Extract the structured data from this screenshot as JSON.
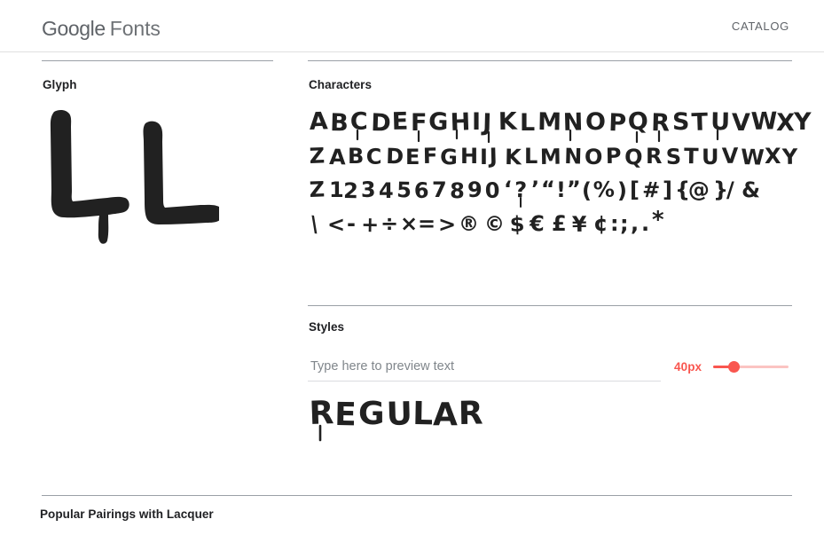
{
  "page": {
    "background": "#ffffff",
    "accent_color": "#f9564f",
    "text_color": "#212121",
    "muted_color": "#5f6368"
  },
  "header": {
    "logo_primary": "Google",
    "logo_secondary": "Fonts",
    "nav": {
      "catalog_label": "CATALOG"
    }
  },
  "glyph_section": {
    "label": "Glyph",
    "glyph_text": "LL"
  },
  "characters_section": {
    "label": "Characters",
    "rows": [
      "ABCDEFGHIJKLMNOPQRSTUVWXY",
      "ZABCDEFGHIJKLMNOPQRSTUVWXY",
      "Z1234567890'?'\"!\"(%)[#]{@}/&",
      "\\<-+÷×=>®©$€£¥¢:;,.*"
    ]
  },
  "styles_section": {
    "label": "Styles",
    "preview_input": {
      "placeholder": "Type here to preview text",
      "value": ""
    },
    "size": {
      "value_label": "40px",
      "value": 40,
      "min": 8,
      "max": 150,
      "percent": 22
    },
    "style_name": "REGULAR"
  },
  "pairings_section": {
    "label": "Popular Pairings with Lacquer"
  }
}
